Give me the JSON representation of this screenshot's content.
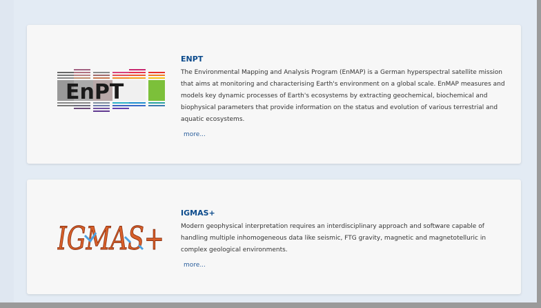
{
  "cards": [
    {
      "logo_text": "EnPT",
      "title": "ENPT",
      "description": "The Environmental Mapping and Analysis Program (EnMAP) is a German hyperspectral satellite mission that aims at monitoring and characterising Earth's environment on a global scale. EnMAP measures and models key dynamic processes of Earth's ecosystems by extracting geochemical, biochemical and biophysical parameters that provide information on the status and evolution of various terrestrial and aquatic ecosystems.",
      "more_label": "more..."
    },
    {
      "logo_text": "IGMAS+",
      "title": "IGMAS+",
      "description": "Modern geophysical interpretation requires an interdisciplinary approach and software capable of handling multiple inhomogeneous data like seismic, FTG gravity, magnetic and magnetotelluric in complex geological environments.",
      "more_label": "more..."
    }
  ],
  "colors": {
    "title": "#0c4b8c",
    "link": "#2a5e9c",
    "background": "#e3ebf4",
    "card": "#f7f7f7"
  }
}
